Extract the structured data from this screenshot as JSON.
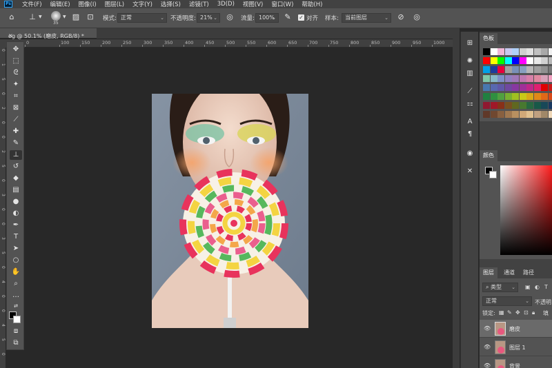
{
  "app": {
    "logo": "Ps"
  },
  "menu": [
    "文件(F)",
    "编辑(E)",
    "图像(I)",
    "图层(L)",
    "文字(Y)",
    "选择(S)",
    "滤镜(T)",
    "3D(D)",
    "视图(V)",
    "窗口(W)",
    "帮助(H)"
  ],
  "options": {
    "brush_size": "35",
    "mode_label": "模式:",
    "mode_value": "正常",
    "opacity_label": "不透明度:",
    "opacity_value": "21%",
    "flow_label": "流量:",
    "flow_value": "100%",
    "align_label": "对齐",
    "sample_label": "样本:",
    "sample_value": "当前图层"
  },
  "document": {
    "tab_title": "og @ 50.1% (磨皮, RGB/8) *",
    "close": "×"
  },
  "ruler": {
    "h": [
      "0",
      "100",
      "150",
      "200",
      "250",
      "300",
      "350",
      "400",
      "450",
      "500",
      "550",
      "600",
      "650",
      "700",
      "750",
      "800",
      "850",
      "900",
      "950",
      "1000",
      "1050",
      "1100",
      "1150",
      "1200",
      "1250",
      "1300",
      "1350"
    ],
    "v": [
      "0",
      "1",
      "5",
      "0",
      "2",
      "0",
      "0",
      "2",
      "5",
      "0",
      "3",
      "0",
      "0",
      "3",
      "5",
      "0",
      "4",
      "0",
      "0",
      "4",
      "5",
      "0"
    ]
  },
  "panels": {
    "swatches_tab": "色板",
    "color_tab": "颜色",
    "layers_tabs": [
      "图层",
      "通道",
      "路径"
    ],
    "filter_kind": "类型",
    "blend_mode": "正常",
    "opacity_label": "不透明",
    "lock_label": "锁定:",
    "fill_label": "填",
    "layers": [
      {
        "name": "磨皮"
      },
      {
        "name": "图层 1"
      },
      {
        "name": "背景"
      }
    ]
  },
  "colors": {
    "swatches": [
      [
        "#000000",
        "#ffffff",
        "#f0b8d8",
        "#c8c8f0",
        "#b0d0f8",
        "#d0d0d0",
        "#e0e0e0",
        "#c0c0c0",
        "#a8a8a8",
        "#f0f0f0"
      ],
      [
        "#ff0000",
        "#ffff00",
        "#00ff00",
        "#00ffff",
        "#0000ff",
        "#ff00ff",
        "#ffffff",
        "#e8e8e8",
        "#d0d0d0",
        "#b8b8b8"
      ],
      [
        "#00a0e8",
        "#1c3c9c",
        "#e8003c",
        "#a0a0a0",
        "#7890b8",
        "#88a0c0",
        "#b8b8b8",
        "#a0a0a0",
        "#909090",
        "#787878"
      ],
      [
        "#80c8a8",
        "#88b8c8",
        "#8090c8",
        "#9080c0",
        "#a078b8",
        "#c078b0",
        "#d880a8",
        "#e088a0",
        "#d8a0b8",
        "#f0a0c0"
      ],
      [
        "#4878b0",
        "#5868b0",
        "#6058a8",
        "#7048a0",
        "#8838a0",
        "#a03098",
        "#c02888",
        "#e02070",
        "#e00000",
        "#c81818"
      ],
      [
        "#208040",
        "#309040",
        "#50a040",
        "#78b030",
        "#a0c020",
        "#c8c818",
        "#d8a818",
        "#e08818",
        "#e06818",
        "#d84818"
      ],
      [
        "#901830",
        "#a01828",
        "#883018",
        "#785020",
        "#606820",
        "#487830",
        "#286840",
        "#185848",
        "#184858",
        "#183860"
      ],
      [
        "#603828",
        "#704830",
        "#886040",
        "#a07850",
        "#b89060",
        "#d0a878",
        "#e0c090",
        "#c0a080",
        "#a08868",
        "#f0d8b8"
      ]
    ]
  }
}
